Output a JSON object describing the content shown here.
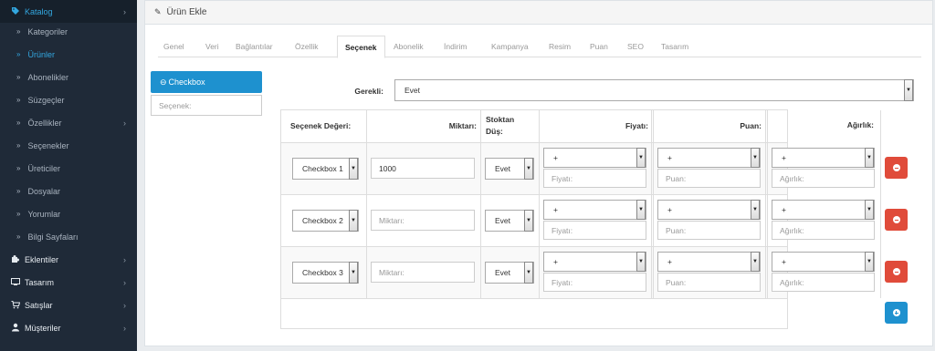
{
  "sidebar": {
    "catalog": {
      "label": "Katalog",
      "icon": "tag-icon"
    },
    "sub_items": [
      "Kategoriler",
      "Ürünler",
      "Abonelikler",
      "Süzgeçler",
      "Özellikler",
      "Seçenekler",
      "Üreticiler",
      "Dosyalar",
      "Yorumlar",
      "Bilgi Sayfaları"
    ],
    "active_sub": "Ürünler",
    "main_items": [
      {
        "label": "Eklentiler",
        "icon": "puzzle-icon"
      },
      {
        "label": "Tasarım",
        "icon": "monitor-icon"
      },
      {
        "label": "Satışlar",
        "icon": "cart-icon"
      },
      {
        "label": "Müşteriler",
        "icon": "user-icon"
      }
    ]
  },
  "panel": {
    "title": "Ürün Ekle"
  },
  "tabs": [
    "Genel",
    "Veri",
    "Bağlantılar",
    "Özellik",
    "Seçenek",
    "Abonelik",
    "İndirim",
    "Kampanya",
    "Resim",
    "Puan",
    "SEO",
    "Tasarım"
  ],
  "active_tab": "Seçenek",
  "options_list": {
    "active": "Checkbox",
    "input_placeholder": "Seçenek:"
  },
  "required": {
    "label": "Gerekli:",
    "value": "Evet"
  },
  "table": {
    "headers": {
      "value": "Seçenek Değeri:",
      "qty": "Miktarı:",
      "stock_1": "Stoktan",
      "stock_2": "Düş:",
      "price": "Fiyatı:",
      "points": "Puan:",
      "weight": "Ağırlık:"
    },
    "rows": [
      {
        "value": "Checkbox 1",
        "qty": "1000",
        "qty_placeholder": "Miktarı:",
        "subtract": "Evet",
        "price_prefix": "+",
        "price_placeholder": "Fiyatı:",
        "points_prefix": "+",
        "points_placeholder": "Puan:",
        "weight_prefix": "+",
        "weight_placeholder": "Ağırlık:"
      },
      {
        "value": "Checkbox 2",
        "qty": "",
        "qty_placeholder": "Miktarı:",
        "subtract": "Evet",
        "price_prefix": "+",
        "price_placeholder": "Fiyatı:",
        "points_prefix": "+",
        "points_placeholder": "Puan:",
        "weight_prefix": "+",
        "weight_placeholder": "Ağırlık:"
      },
      {
        "value": "Checkbox 3",
        "qty": "",
        "qty_placeholder": "Miktarı:",
        "subtract": "Evet",
        "price_prefix": "+",
        "price_placeholder": "Fiyatı:",
        "points_prefix": "+",
        "points_placeholder": "Puan:",
        "weight_prefix": "+",
        "weight_placeholder": "Ağırlık:"
      }
    ]
  },
  "colors": {
    "sidebar_bg": "#1f2a38",
    "accent": "#1e91cf",
    "danger": "#e04b3a"
  }
}
